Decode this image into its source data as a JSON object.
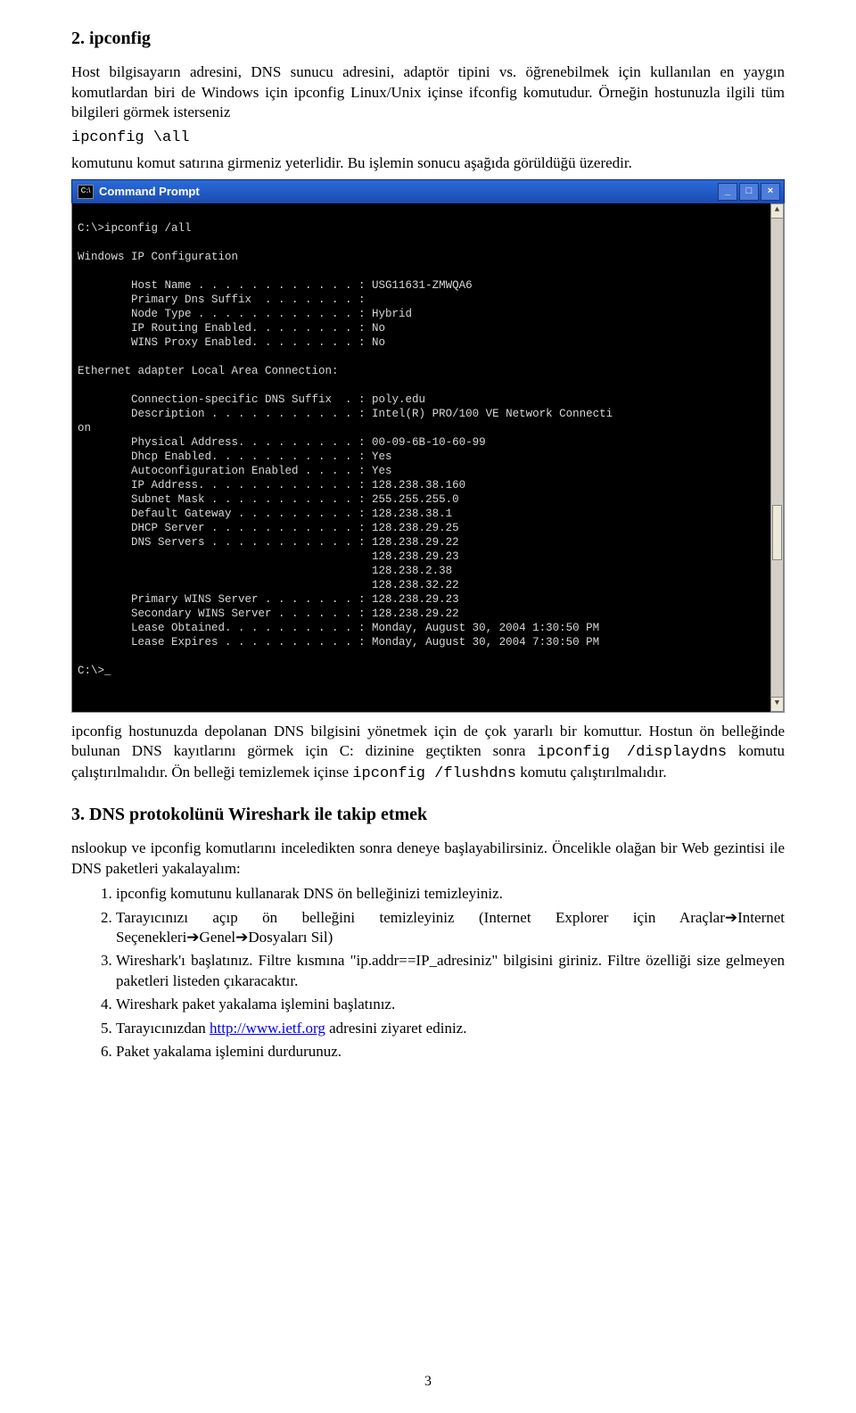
{
  "heading1": "2. ipconfig",
  "para1a": "Host bilgisayarın adresini, DNS sunucu adresini, adaptör tipini vs. öğrenebilmek için kullanılan en yaygın komutlardan biri de Windows için ipconfig Linux/Unix içinse ifconfig komutudur. Örneğin hostunuzla ilgili tüm bilgileri görmek isterseniz",
  "code1": "ipconfig \\all",
  "para1b": "komutunu komut satırına girmeniz yeterlidir. Bu işlemin sonucu aşağıda görüldüğü üzeredir.",
  "titlebar_title": "Command Prompt",
  "terminal_text": "C:\\>ipconfig /all\n\nWindows IP Configuration\n\n        Host Name . . . . . . . . . . . . : USG11631-ZMWQA6\n        Primary Dns Suffix  . . . . . . . :\n        Node Type . . . . . . . . . . . . : Hybrid\n        IP Routing Enabled. . . . . . . . : No\n        WINS Proxy Enabled. . . . . . . . : No\n\nEthernet adapter Local Area Connection:\n\n        Connection-specific DNS Suffix  . : poly.edu\n        Description . . . . . . . . . . . : Intel(R) PRO/100 VE Network Connecti\non\n        Physical Address. . . . . . . . . : 00-09-6B-10-60-99\n        Dhcp Enabled. . . . . . . . . . . : Yes\n        Autoconfiguration Enabled . . . . : Yes\n        IP Address. . . . . . . . . . . . : 128.238.38.160\n        Subnet Mask . . . . . . . . . . . : 255.255.255.0\n        Default Gateway . . . . . . . . . : 128.238.38.1\n        DHCP Server . . . . . . . . . . . : 128.238.29.25\n        DNS Servers . . . . . . . . . . . : 128.238.29.22\n                                            128.238.29.23\n                                            128.238.2.38\n                                            128.238.32.22\n        Primary WINS Server . . . . . . . : 128.238.29.23\n        Secondary WINS Server . . . . . . : 128.238.29.22\n        Lease Obtained. . . . . . . . . . : Monday, August 30, 2004 1:30:50 PM\n        Lease Expires . . . . . . . . . . : Monday, August 30, 2004 7:30:50 PM\n\nC:\\>_",
  "para2a": "ipconfig hostunuzda  depolanan DNS bilgisini yönetmek için de çok yararlı bir komuttur. Hostun ön belleğinde bulunan DNS kayıtlarını görmek için C: dizinine geçtikten sonra ",
  "code2": "ipconfig /displaydns",
  "para2b": " komutu çalıştırılmalıdır. Ön belleği temizlemek içinse ",
  "code3": "ipconfig /flushdns",
  "para2c": " komutu çalıştırılmalıdır.",
  "heading2": "3. DNS protokolünü Wireshark ile takip etmek",
  "para3": "nslookup ve ipconfig komutlarını inceledikten sonra deneye başlayabilirsiniz. Öncelikle olağan bir Web gezintisi ile DNS paketleri yakalayalım:",
  "li1": "ipconfig komutunu kullanarak DNS ön belleğinizi temizleyiniz.",
  "li2a": "Tarayıcınızı açıp ön belleğini temizleyiniz (Internet Explorer için Araçlar",
  "li2b": "Internet Seçenekleri",
  "li2c": "Genel",
  "li2d": "Dosyaları Sil)",
  "li3": "Wireshark'ı başlatınız. Filtre kısmına \"ip.addr==IP_adresiniz\" bilgisini giriniz. Filtre özelliği size gelmeyen paketleri listeden çıkaracaktır.",
  "li4": "Wireshark paket yakalama işlemini başlatınız.",
  "li5a": "Tarayıcınızdan ",
  "li5link": "http://www.ietf.org",
  "li5b": " adresini ziyaret ediniz.",
  "li6": "Paket yakalama işlemini durdurunuz.",
  "arrow": "➔",
  "pagenum": "3",
  "minimize_label": "_",
  "maximize_label": "□",
  "close_label": "×",
  "sb_up": "▲",
  "sb_down": "▼",
  "tb_icon_text": "C:\\"
}
